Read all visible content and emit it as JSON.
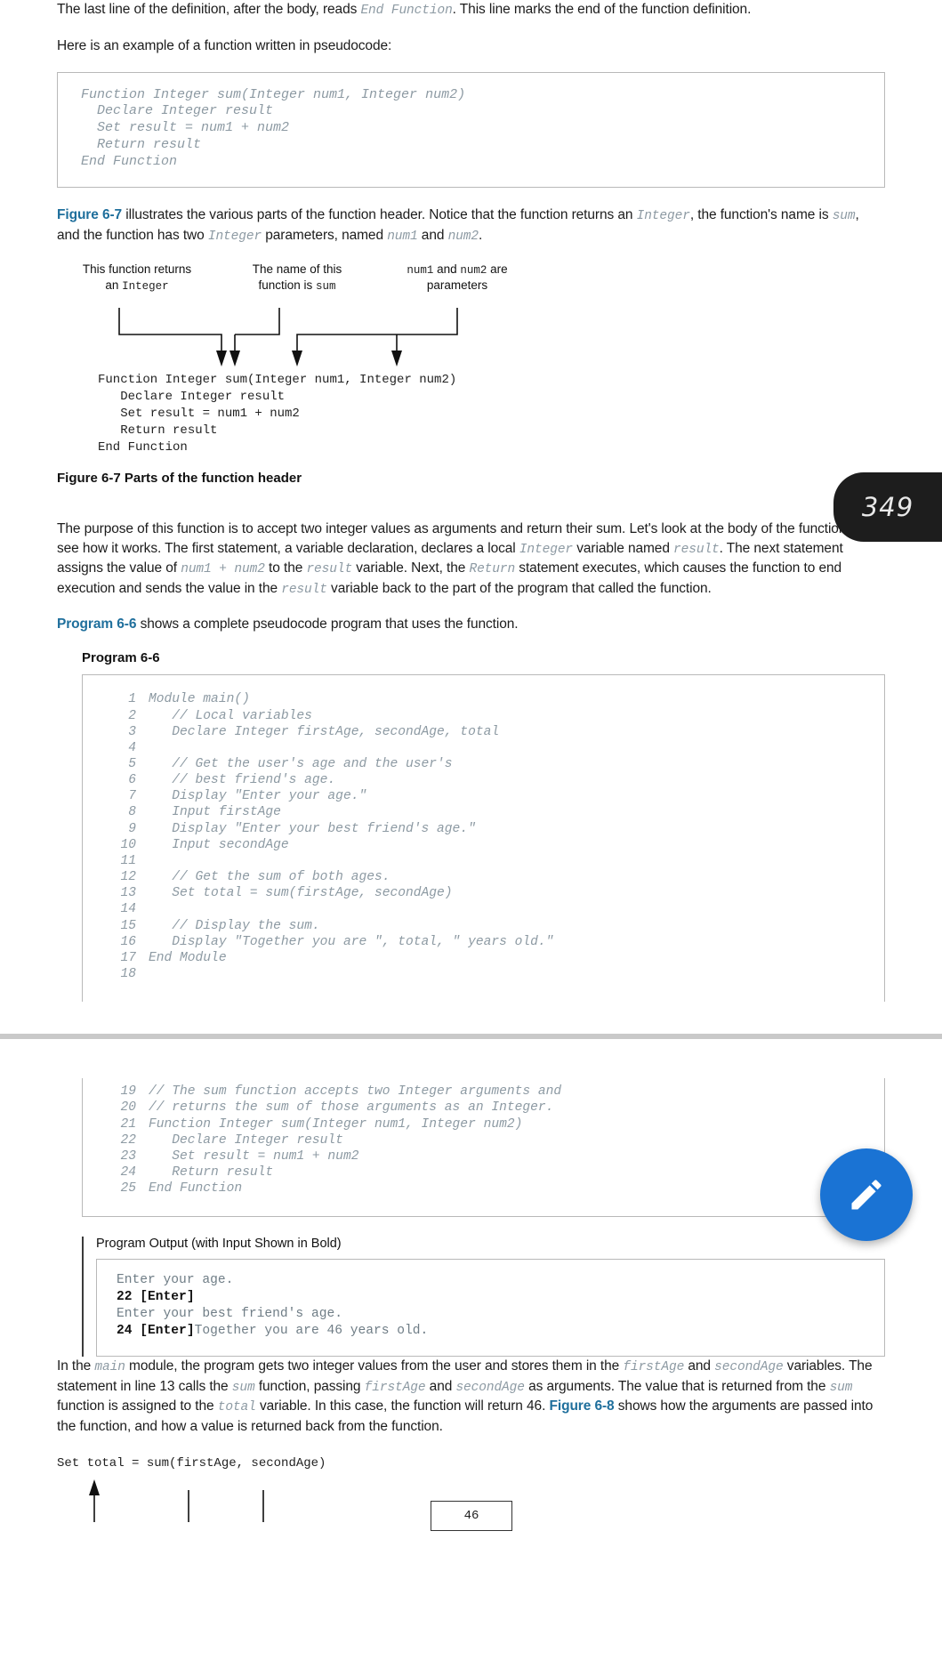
{
  "page_badge": {
    "number": "349"
  },
  "intro": {
    "para1_a": "The last line of the definition, after the body, reads ",
    "para1_code": "End Function",
    "para1_b": ". This line marks the end of the function definition.",
    "para2": "Here is an example of a function written in pseudocode:"
  },
  "example_code": "Function Integer sum(Integer num1, Integer num2)\n  Declare Integer result\n  Set result = num1 + num2\n  Return result\nEnd Function",
  "figure_intro": {
    "xref": "Figure 6-7",
    "text_a": " illustrates the various parts of the function header. Notice that the function returns an ",
    "code1": "Integer",
    "text_b": ", the function's name is ",
    "code2": "sum",
    "text_c": ", and the function has two ",
    "code3": "Integer",
    "text_d": " parameters, named ",
    "code4": "num1",
    "text_e": " and ",
    "code5": "num2",
    "text_f": "."
  },
  "figure": {
    "labels": [
      {
        "line1": "This function returns",
        "line2_plain": "an ",
        "line2_code": "Integer"
      },
      {
        "line1": "The name of this",
        "line2_plain": "function is ",
        "line2_code": "sum"
      },
      {
        "line1_code_a": "num1",
        "line1_plain": " and ",
        "line1_code_b": "num2",
        "line1_plain_b": " are",
        "line2": "parameters"
      }
    ],
    "code": "Function Integer sum(Integer num1, Integer num2)\n   Declare Integer result\n   Set result = num1 + num2\n   Return result\nEnd Function",
    "caption": "Figure 6-7 Parts of the function header"
  },
  "purpose_para": {
    "a": "The purpose of this function is to accept two integer values as arguments and return their sum. Let's look at the body of the function to see how it works. The first statement, a variable declaration, declares a local ",
    "code1": "Integer",
    "b": " variable named ",
    "code2": "result",
    "c": ". The next statement assigns the value of ",
    "code3": "num1 + num2",
    "d": " to the ",
    "code4": "result",
    "e": " variable. Next, the ",
    "code5": "Return",
    "f": " statement executes, which causes the function to end execution and sends the value in the ",
    "code6": "result",
    "g": " variable back to the part of the program that called the function."
  },
  "program_intro": {
    "xref": "Program 6-6",
    "text": " shows a complete pseudocode program that uses the function."
  },
  "program": {
    "title": "Program 6-6",
    "lines_part1": [
      {
        "n": "1",
        "code": "Module main()"
      },
      {
        "n": "2",
        "code": "   // Local variables"
      },
      {
        "n": "3",
        "code": "   Declare Integer firstAge, secondAge, total"
      },
      {
        "n": "4",
        "code": ""
      },
      {
        "n": "5",
        "code": "   // Get the user's age and the user's"
      },
      {
        "n": "6",
        "code": "   // best friend's age."
      },
      {
        "n": "7",
        "code": "   Display \"Enter your age.\""
      },
      {
        "n": "8",
        "code": "   Input firstAge"
      },
      {
        "n": "9",
        "code": "   Display \"Enter your best friend's age.\""
      },
      {
        "n": "10",
        "code": "   Input secondAge"
      },
      {
        "n": "11",
        "code": ""
      },
      {
        "n": "12",
        "code": "   // Get the sum of both ages."
      },
      {
        "n": "13",
        "code": "   Set total = sum(firstAge, secondAge)"
      },
      {
        "n": "14",
        "code": ""
      },
      {
        "n": "15",
        "code": "   // Display the sum."
      },
      {
        "n": "16",
        "code": "   Display \"Together you are \", total, \" years old.\""
      },
      {
        "n": "17",
        "code": "End Module"
      },
      {
        "n": "18",
        "code": ""
      }
    ],
    "lines_part2": [
      {
        "n": "19",
        "code": "// The sum function accepts two Integer arguments and"
      },
      {
        "n": "20",
        "code": "// returns the sum of those arguments as an Integer."
      },
      {
        "n": "21",
        "code": "Function Integer sum(Integer num1, Integer num2)"
      },
      {
        "n": "22",
        "code": "   Declare Integer result"
      },
      {
        "n": "23",
        "code": "   Set result = num1 + num2"
      },
      {
        "n": "24",
        "code": "   Return result"
      },
      {
        "n": "25",
        "code": "End Function"
      }
    ]
  },
  "output": {
    "title": "Program Output (with Input Shown in Bold)",
    "lines": [
      {
        "text": "Enter your age.",
        "bold": ""
      },
      {
        "text": "",
        "bold": "22 [Enter]"
      },
      {
        "text": "Enter your best friend's age.",
        "bold": ""
      },
      {
        "bold": "24 [Enter]",
        "text": "Together you are 46 years old."
      }
    ]
  },
  "closing_para": {
    "a": "In the ",
    "code1": "main",
    "b": " module, the program gets two integer values from the user and stores them in the ",
    "code2": "firstAge",
    "c": " and ",
    "code3": "secondAge",
    "d": " variables. The statement in line 13 calls the ",
    "code4": "sum",
    "e": " function, passing ",
    "code5": "firstAge",
    "f": " and ",
    "code6": "secondAge",
    "g": " as arguments. The value that is returned from the ",
    "code7": "sum",
    "h": " function is assigned to the ",
    "code8": "total",
    "i": " variable. In this case, the function will return 46. ",
    "xref": "Figure 6-8",
    "j": " shows how the arguments are passed into the function, and how a value is returned back from the function."
  },
  "tail": {
    "code": "Set total = sum(firstAge, secondAge)",
    "box_value": "46"
  },
  "fab": {
    "icon": "pencil-icon",
    "color": "#1a73d4"
  }
}
